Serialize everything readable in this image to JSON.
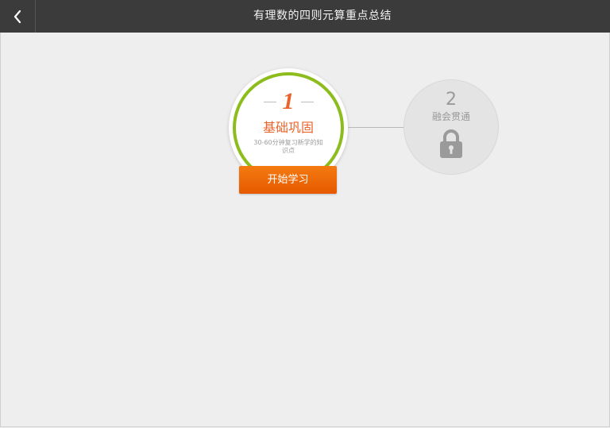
{
  "header": {
    "title": "有理数的四则元算重点总结",
    "back_icon": "chevron-left-icon"
  },
  "stages": [
    {
      "number": "1",
      "name": "基础巩固",
      "description": "30-60分钟复习新学的知识点",
      "button_label": "开始学习",
      "status": "active",
      "accent_color": "#8dbd1c",
      "text_color": "#e9632a"
    },
    {
      "number": "2",
      "name": "融会贯通",
      "status": "locked",
      "icon": "lock-icon"
    }
  ],
  "colors": {
    "header_bg": "#3b3b3b",
    "page_bg": "#eeeeee",
    "button_bg": "#ef6c08",
    "locked_gray": "#9a9a9a"
  }
}
